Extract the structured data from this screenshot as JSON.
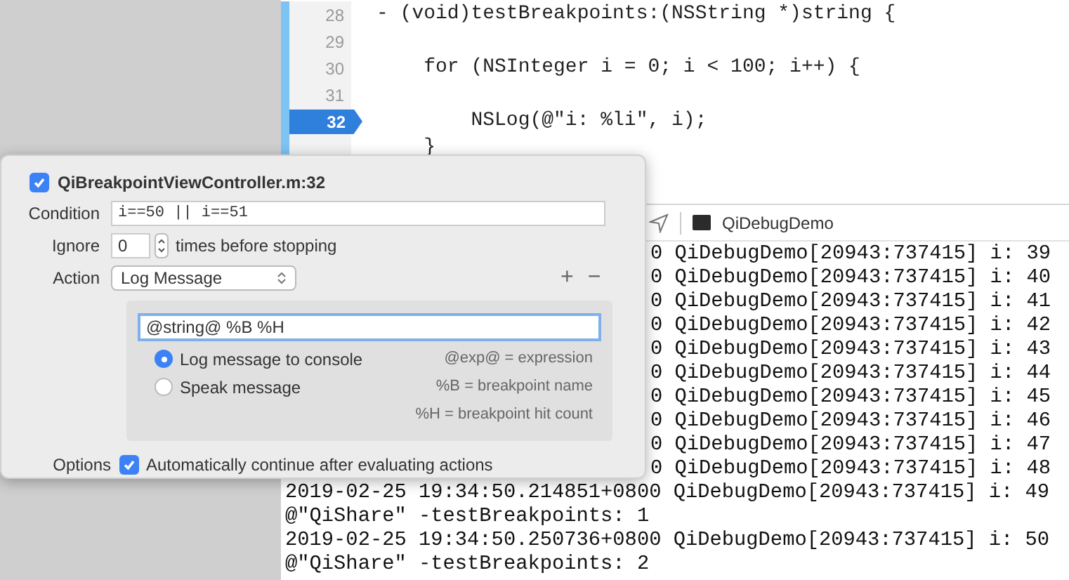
{
  "editor": {
    "lines": [
      {
        "number": "28",
        "code": "- (void)testBreakpoints:(NSString *)string {",
        "selected": false
      },
      {
        "number": "29",
        "selected": false
      },
      {
        "number": "30",
        "code": "    for (NSInteger i = 0; i < 100; i++) {",
        "selected": false
      },
      {
        "number": "31",
        "selected": false
      },
      {
        "number": "32",
        "code": "        NSLog(@\"i: %li\", i);",
        "selected": true
      },
      {
        "code": "    }",
        "selected": false
      }
    ]
  },
  "debug_bar": {
    "process": "QiDebugDemo"
  },
  "console": {
    "lines": [
      {
        "kind": "partial",
        "text": "0 QiDebugDemo[20943:737415] i: 39"
      },
      {
        "kind": "partial",
        "text": "0 QiDebugDemo[20943:737415] i: 40"
      },
      {
        "kind": "partial",
        "text": "0 QiDebugDemo[20943:737415] i: 41"
      },
      {
        "kind": "partial",
        "text": "0 QiDebugDemo[20943:737415] i: 42"
      },
      {
        "kind": "partial",
        "text": "0 QiDebugDemo[20943:737415] i: 43"
      },
      {
        "kind": "partial",
        "text": "0 QiDebugDemo[20943:737415] i: 44"
      },
      {
        "kind": "partial",
        "text": "0 QiDebugDemo[20943:737415] i: 45"
      },
      {
        "kind": "partial",
        "text": "0 QiDebugDemo[20943:737415] i: 46"
      },
      {
        "kind": "partial",
        "text": "0 QiDebugDemo[20943:737415] i: 47"
      },
      {
        "kind": "partial",
        "text": "0 QiDebugDemo[20943:737415] i: 48"
      },
      {
        "kind": "full",
        "text": "2019-02-25 19:34:50.214851+0800 QiDebugDemo[20943:737415] i: 49"
      },
      {
        "kind": "full",
        "text": "@\"QiShare\" -testBreakpoints: 1"
      },
      {
        "kind": "full",
        "text": "2019-02-25 19:34:50.250736+0800 QiDebugDemo[20943:737415] i: 50"
      },
      {
        "kind": "full",
        "text": "@\"QiShare\" -testBreakpoints: 2"
      }
    ]
  },
  "popover": {
    "title": "QiBreakpointViewController.m:32",
    "enabled": true,
    "condition": {
      "label": "Condition",
      "value": "i==50 || i==51"
    },
    "ignore": {
      "label": "Ignore",
      "value": "0",
      "suffix": "times before stopping"
    },
    "action": {
      "label": "Action",
      "value": "Log Message",
      "add": "+",
      "remove": "−"
    },
    "message": {
      "value": "@string@ %B %H"
    },
    "outputs": [
      {
        "label": "Log message to console",
        "selected": true
      },
      {
        "label": "Speak message",
        "selected": false
      }
    ],
    "hints": [
      "@exp@ = expression",
      "%B = breakpoint name",
      "%H = breakpoint hit count"
    ],
    "options": {
      "label": "Options",
      "text": "Automatically continue after evaluating actions",
      "checked": true
    }
  }
}
